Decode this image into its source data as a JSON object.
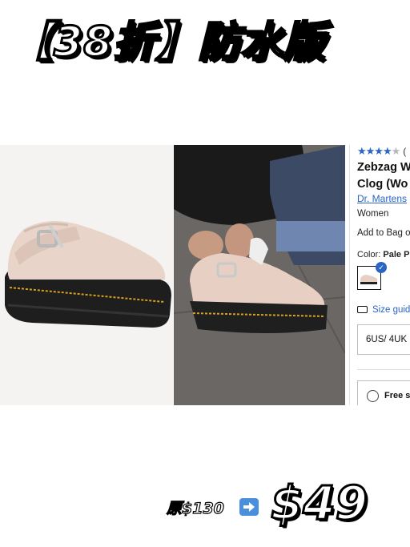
{
  "headline": "【38折】防水版",
  "product": {
    "rating_stars": "★★★★",
    "rating_star_off": "★",
    "rating_count_prefix": "(",
    "title_line1": "Zebzag W",
    "title_line2": "Clog (Wo",
    "brand": "Dr. Martens",
    "gender": "Women",
    "add_to_bag": "Add to Bag o",
    "color_label": "Color: ",
    "color_value": "Pale Pin",
    "size_guide": "Size guid",
    "size_selected": "6US/ 4UK",
    "shipping_option": "Free sh"
  },
  "price": {
    "original": "原$130",
    "arrow_icon": "right-arrow-icon",
    "sale": "$49"
  },
  "colors": {
    "accent_blue": "#2a64c5",
    "shoe_pink": "#e8cfc3"
  }
}
